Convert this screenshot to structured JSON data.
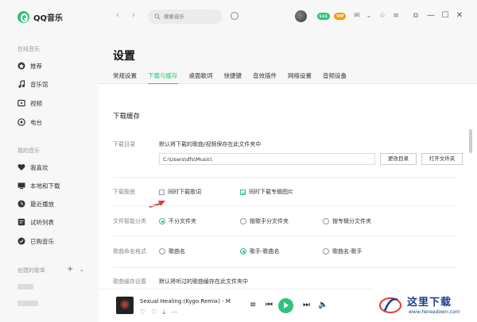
{
  "app": {
    "name": "QQ音乐"
  },
  "sidebar": {
    "online_label": "在线音乐",
    "online_items": [
      {
        "label": "推荐",
        "icon": "recommend-icon"
      },
      {
        "label": "音乐馆",
        "icon": "music-note-icon"
      },
      {
        "label": "视频",
        "icon": "video-icon"
      },
      {
        "label": "电台",
        "icon": "radio-icon"
      }
    ],
    "my_label": "我的音乐",
    "my_items": [
      {
        "label": "我喜欢",
        "icon": "heart-icon"
      },
      {
        "label": "本地和下载",
        "icon": "computer-icon"
      },
      {
        "label": "最近播放",
        "icon": "clock-icon"
      },
      {
        "label": "试听列表",
        "icon": "list-icon"
      },
      {
        "label": "已购音乐",
        "icon": "purchased-icon"
      }
    ],
    "created_label": "创建的歌单",
    "add_symbol": "+",
    "more_symbol": "⌄"
  },
  "topbar": {
    "back": "‹",
    "forward": "›",
    "search_placeholder": "搜索音乐",
    "badges": [
      "Lv1",
      "VIP"
    ],
    "win_min": "—",
    "win_max": "☐",
    "win_close": "✕"
  },
  "header": {
    "title": "设置",
    "tabs": [
      "常规设置",
      "下载与缓存",
      "桌面歌词",
      "快捷键",
      "音效插件",
      "网络设置",
      "音频设备"
    ],
    "active_tab": 1
  },
  "settings": {
    "section_title": "下载缓存",
    "download_dir": {
      "label": "下载目录",
      "desc": "默认将下载的歌曲/视频保存在此文件夹中",
      "path": "C:\\Users\\dfs\\Music\\",
      "change_btn": "更改目录",
      "open_btn": "打开文件夹"
    },
    "download_song": {
      "label": "下载歌曲",
      "opt_lyrics": "同时下载歌词",
      "opt_lyrics_checked": false,
      "opt_cover": "同时下载专辑图片",
      "opt_cover_checked": true
    },
    "smart_folder": {
      "label": "文件智能分类",
      "options": [
        "不分文件夹",
        "按歌手分文件夹",
        "按专辑分文件夹"
      ],
      "selected": 0
    },
    "naming": {
      "label": "歌曲命名格式",
      "options": [
        "歌曲名",
        "歌手-歌曲名",
        "歌曲名-歌手"
      ],
      "selected": 1
    },
    "cache": {
      "label": "歌曲缓存设置",
      "desc": "默认将听过的歌曲缓存在此文件夹中"
    }
  },
  "player": {
    "song": "Sexual Healing (Kygo Remix) - M"
  },
  "watermark": {
    "text": "这里下载",
    "url": "www.hereadown.com"
  },
  "colors": {
    "accent": "#31c27c",
    "arrow": "#e53935"
  }
}
